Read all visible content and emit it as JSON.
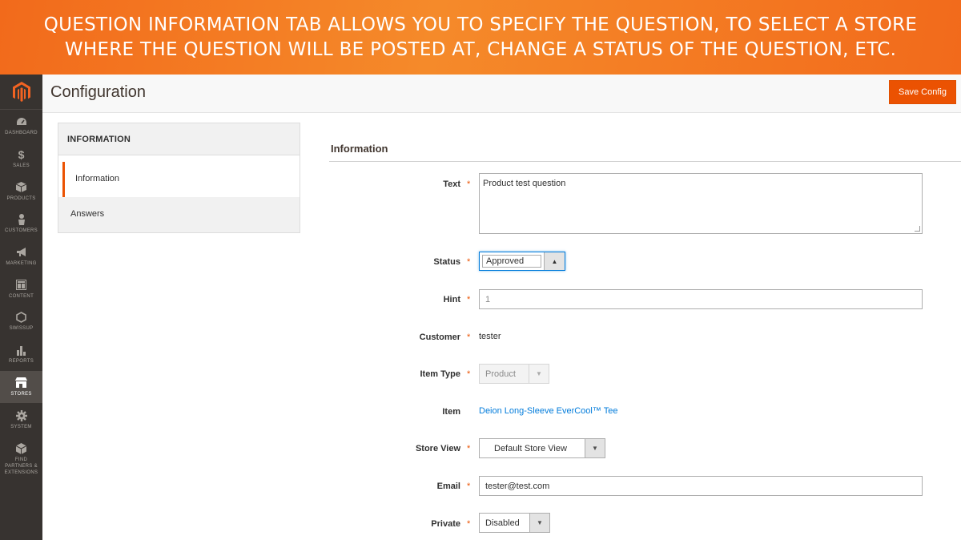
{
  "banner": {
    "line1": "QUESTION INFORMATION TAB ALLOWS YOU TO SPECIFY THE QUESTION, TO SELECT A STORE",
    "line2": "WHERE THE QUESTION WILL BE POSTED AT, CHANGE A STATUS OF THE QUESTION, ETC."
  },
  "sidebar": {
    "items": [
      {
        "label": "DASHBOARD",
        "icon": "dashboard-icon"
      },
      {
        "label": "SALES",
        "icon": "dollar-icon"
      },
      {
        "label": "PRODUCTS",
        "icon": "box-icon"
      },
      {
        "label": "CUSTOMERS",
        "icon": "person-icon"
      },
      {
        "label": "MARKETING",
        "icon": "megaphone-icon"
      },
      {
        "label": "CONTENT",
        "icon": "layout-icon"
      },
      {
        "label": "SWISSUP",
        "icon": "hexagon-icon"
      },
      {
        "label": "REPORTS",
        "icon": "bar-chart-icon"
      },
      {
        "label": "STORES",
        "icon": "store-icon"
      },
      {
        "label": "SYSTEM",
        "icon": "gear-icon"
      },
      {
        "label": "FIND PARTNERS & EXTENSIONS",
        "icon": "cube-icon"
      }
    ],
    "active": "STORES"
  },
  "header": {
    "title": "Configuration",
    "save_label": "Save Config"
  },
  "tabs": {
    "heading": "INFORMATION",
    "items": [
      "Information",
      "Answers"
    ]
  },
  "form": {
    "section_title": "Information",
    "required_mark": "*",
    "text": {
      "label": "Text",
      "value": "Product test question"
    },
    "status": {
      "label": "Status",
      "value": "Approved"
    },
    "hint": {
      "label": "Hint",
      "value": "1"
    },
    "customer": {
      "label": "Customer",
      "value": "tester"
    },
    "item_type": {
      "label": "Item Type",
      "value": "Product"
    },
    "item": {
      "label": "Item",
      "value": "Deion Long-Sleeve EverCool™ Tee"
    },
    "store_view": {
      "label": "Store View",
      "value": "Default Store View"
    },
    "email": {
      "label": "Email",
      "value": "tester@test.com"
    },
    "private": {
      "label": "Private",
      "value": "Disabled"
    }
  },
  "colors": {
    "accent": "#eb5202",
    "sidebar_bg": "#373330",
    "link": "#007bdb"
  }
}
